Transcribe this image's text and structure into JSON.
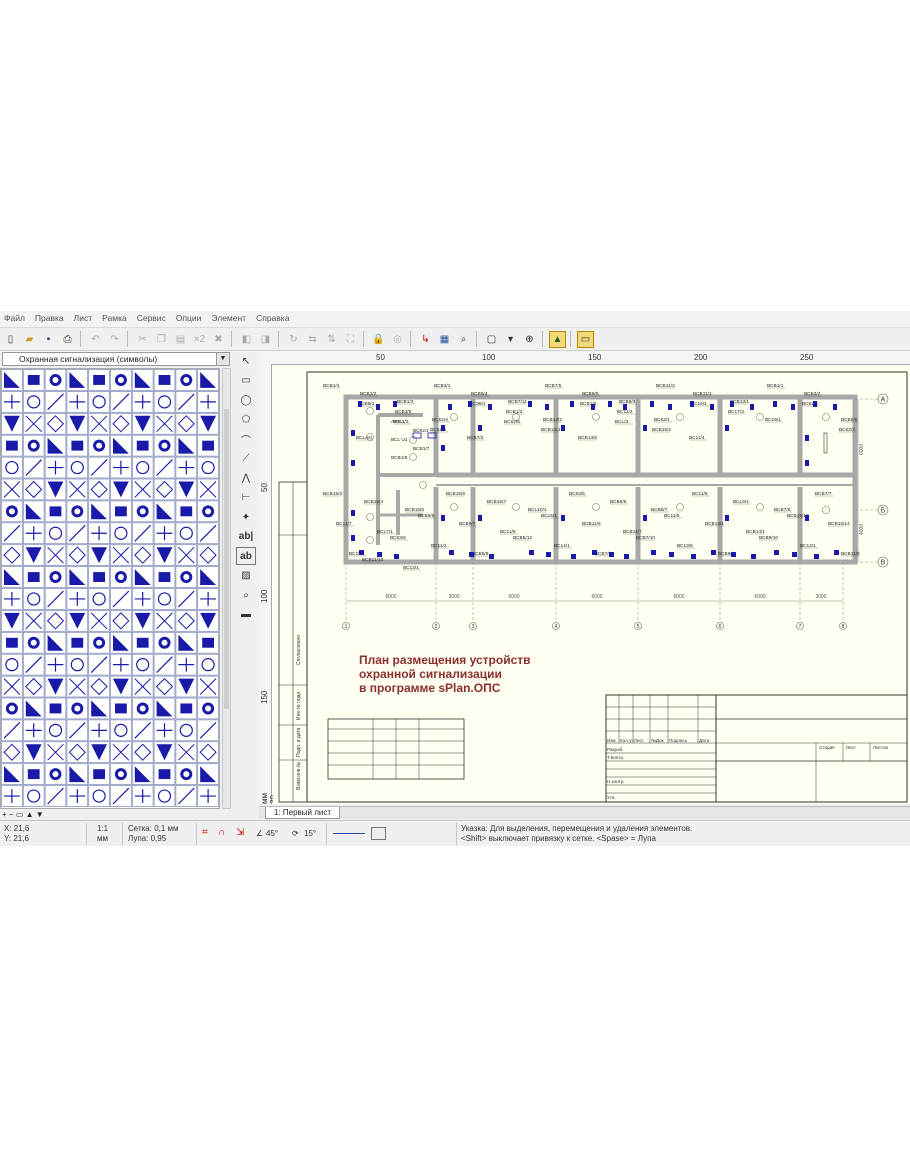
{
  "menu": [
    "Файл",
    "Правка",
    "Лист",
    "Рамка",
    "Сервис",
    "Опции",
    "Элемент",
    "Справка"
  ],
  "library": {
    "selected": "Охранная сигнализация (символы)"
  },
  "ruler": {
    "top": [
      "50",
      "100",
      "150",
      "200",
      "250"
    ],
    "left": [
      "50",
      "100",
      "150",
      "мм 30"
    ]
  },
  "drawing": {
    "title_lines": [
      "План размещения устройств",
      "охранной сигнализации",
      "в программе sPlan.ОПС"
    ],
    "axis_rows": [
      "А",
      "Б",
      "В"
    ],
    "axis_cols": [
      "1",
      "2",
      "3",
      "4",
      "5",
      "6",
      "7",
      "8"
    ],
    "dimensions": [
      "6000",
      "3000",
      "6000",
      "6000",
      "6000",
      "6000",
      "3000",
      "3000"
    ],
    "vertical_dimensions": [
      "6000",
      "4000"
    ],
    "device_labels_top": [
      "ВСВ1/4",
      "ВСВ1/2",
      "ВСВ1/3",
      "ВСВ3/1",
      "ВСВ5/4",
      "ВСВ7/11",
      "ВСВ7/5",
      "ВСВ9/5",
      "ВСВ9/3",
      "ВСВ11/3",
      "ВСВ11/1",
      "ВСВ13/1",
      "ВСВ1/1",
      "ВСВ3/2",
      "ВСВ5/6",
      "ВСВ9/1",
      "ВСВ3/5",
      "ВСК2/4",
      "ВСЭ9/1",
      "ВСВ1/2",
      "ВСВ13/2",
      "ВСВ1/5",
      "ВС11/2",
      "ВСК2/1",
      "ВС15/1",
      "ВС17/3",
      "ВС19/1",
      "ВСК2/2",
      "ВСК2/3",
      "ВСLAN",
      "ВС11/3",
      "ВСК2/5",
      "ВСВ7/2",
      "ВСК2/6",
      "ВСВ13/4",
      "ВСВ13/5",
      "ВСL/3",
      "ВСВ15/2",
      "ВС11/4"
    ],
    "device_labels_bottom": [
      "ВСВ15/3",
      "ВСВ15/4",
      "ВСВ15/5",
      "ВСВ15/6",
      "ВСВ15/7",
      "ВСL10/1",
      "ВСК3/5",
      "ВСВ5/6",
      "ВСВ5/7",
      "ВС11/6",
      "ВСL9/1",
      "ВСВ7/6",
      "ВСВ7/7",
      "ВС11/7",
      "ВСL7/1",
      "ВСВ9/6",
      "ВСВ9/7",
      "ВС11/8",
      "ВСL5/1",
      "ВСВ11/6",
      "ВСВ11/7",
      "ВС11/5",
      "ВСВ13/1",
      "ВСВ14/1",
      "ВСВ15/13",
      "ВСВ15/14",
      "ВС15/1",
      "ВСК3/6",
      "ВС11/2",
      "ВСВ5/8",
      "ВСВ5/12",
      "ВС14/1",
      "ВСВ7/8",
      "ВСВ7/10",
      "ВС13/6",
      "ВСВ9/8",
      "ВСВ9/10",
      "ВС12/1",
      "ВСВ11/8",
      "ВСВ11/10",
      "ВС13/1"
    ],
    "labels_small": [
      "АRК 1",
      "ВСК2/1",
      "ВСL U1",
      "ВСВ1/7",
      "ВСВ1/8"
    ],
    "stamp_rows": [
      "Изм",
      "Кол.уч",
      "Лист",
      "№Док",
      "Подпись",
      "Дата"
    ],
    "stamp_people": [
      "Разраб.",
      "Т.Контр.",
      "Н.контр.",
      "Утв."
    ],
    "stamp_cols": [
      "Стадия",
      "Лист",
      "Листов"
    ],
    "side_stamp": [
      "Взам.инв.№",
      "Подп. и дата",
      "Инв.№ подл.",
      "Согласовано"
    ]
  },
  "tabs": [
    "1: Первый лист"
  ],
  "status": {
    "x": "X: 21,6",
    "y": "Y: 21,6",
    "scale": "1:1",
    "units": "мм",
    "grid": "Сетка: 0,1 мм",
    "zoom": "Лупа:   0,95",
    "angle1": "45°",
    "angle2": "15°",
    "hint1": "Указка: Для выделения, перемещения и удаления элементов.",
    "hint2": "<Shift> выключает привязку к сетке. <Spase> = Лупа"
  }
}
